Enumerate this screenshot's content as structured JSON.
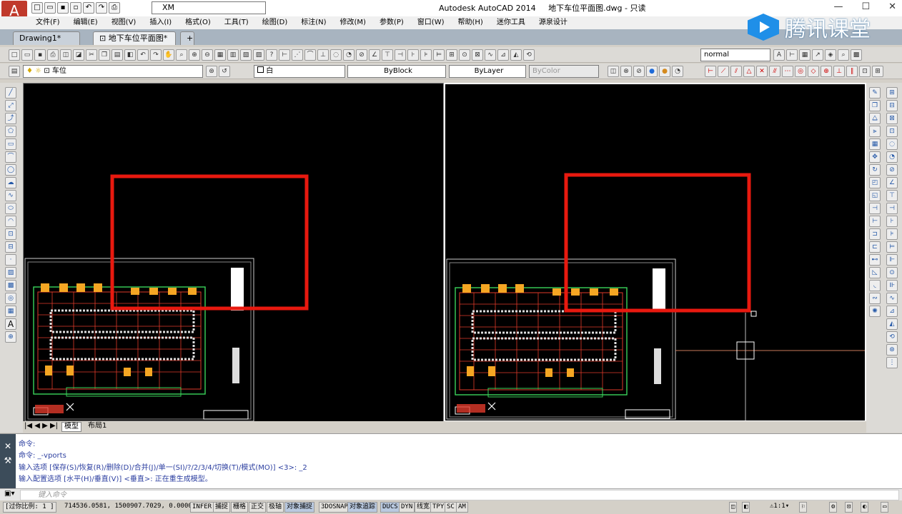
{
  "title": {
    "app": "Autodesk AutoCAD 2014",
    "doc": "地下车位平面图.dwg - 只读",
    "workspace": "XM",
    "app_button": "A"
  },
  "menu": [
    "文件(F)",
    "编辑(E)",
    "视图(V)",
    "插入(I)",
    "格式(O)",
    "工具(T)",
    "绘图(D)",
    "标注(N)",
    "修改(M)",
    "参数(P)",
    "窗口(W)",
    "帮助(H)",
    "迷你工具",
    "源泉设计"
  ],
  "tabs": [
    {
      "label": "Drawing1*"
    },
    {
      "label": "地下车位平面图*",
      "close": "×"
    }
  ],
  "logo_text": "腾讯课堂",
  "toolbar": {
    "style_combo": "normal",
    "layer_combo": "车位",
    "color_combo": "白",
    "linetype_combo": "ByBlock",
    "lineweight_combo": "ByLayer",
    "plotstyle_combo": "ByColor"
  },
  "layout_tabs": [
    "模型",
    "布局1"
  ],
  "command_lines": [
    "命令:",
    "命令: _-vports",
    "输入选项 [保存(S)/恢复(R)/删除(D)/合并(J)/单一(SI)/?/2/3/4/切换(T)/模式(MO)] <3>: _2",
    "输入配置选项 [水平(H)/垂直(V)] <垂直>:  正在重生成模型。"
  ],
  "prompt_placeholder": "键入命令",
  "status": {
    "scale": "[过你比例: 1 ]",
    "coords": "714536.0581, 1500907.7029, 0.0000",
    "toggles": [
      "INFER",
      "捕捉",
      "栅格",
      "正交",
      "极轴",
      "对象捕捉",
      "3DOSNAP",
      "对象追踪",
      "DUCS",
      "DYN",
      "线宽",
      "TPY",
      "SC",
      "AM"
    ],
    "active": [
      "对象捕捉",
      "对象追踪",
      "DUCS"
    ],
    "annot_scale": "1:1"
  },
  "colors": {
    "canvas": "#000000",
    "highlight_box": "#e8190f",
    "plan_lines": "#e03a2a",
    "plan_green": "#3ad45a",
    "command_text": "#2c3fa0"
  }
}
